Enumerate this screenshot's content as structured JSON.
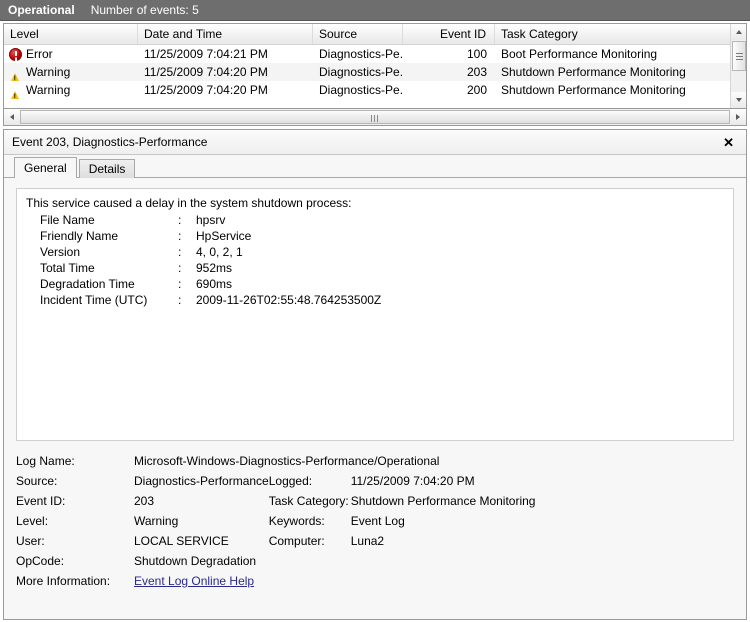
{
  "status_strip": {
    "scope": "Operational",
    "count_text": "Number of events: 5"
  },
  "event_list": {
    "columns": [
      {
        "label": "Level",
        "key": "level"
      },
      {
        "label": "Date and Time",
        "key": "date"
      },
      {
        "label": "Source",
        "key": "source"
      },
      {
        "label": "Event ID",
        "key": "event_id"
      },
      {
        "label": "Task Category",
        "key": "task"
      }
    ],
    "rows": [
      {
        "icon": "error-icon",
        "level": "Error",
        "date": "11/25/2009 7:04:21 PM",
        "source": "Diagnostics-Pe...",
        "event_id": "100",
        "task": "Boot Performance Monitoring"
      },
      {
        "icon": "warning-icon",
        "level": "Warning",
        "date": "11/25/2009 7:04:20 PM",
        "source": "Diagnostics-Pe...",
        "event_id": "203",
        "task": "Shutdown Performance Monitoring"
      },
      {
        "icon": "warning-icon",
        "level": "Warning",
        "date": "11/25/2009 7:04:20 PM",
        "source": "Diagnostics-Pe...",
        "event_id": "200",
        "task": "Shutdown Performance Monitoring"
      }
    ]
  },
  "detail": {
    "title": "Event 203, Diagnostics-Performance",
    "close_label": "✕",
    "tabs": [
      {
        "label": "General",
        "active": true
      },
      {
        "label": "Details",
        "active": false
      }
    ],
    "message": {
      "headline": "This service caused a delay in the system shutdown process:",
      "separator": ":",
      "fields": [
        {
          "key": "File Name",
          "value": "hpsrv"
        },
        {
          "key": "Friendly Name",
          "value": "HpService"
        },
        {
          "key": "Version",
          "value": "4, 0, 2, 1"
        },
        {
          "key": "Total Time",
          "value": "952ms"
        },
        {
          "key": "Degradation Time",
          "value": "690ms"
        },
        {
          "key": "Incident Time (UTC)",
          "value": "2009-11-26T02:55:48.764253500Z"
        }
      ]
    },
    "meta": {
      "log_name_label": "Log Name:",
      "log_name_value": "Microsoft-Windows-Diagnostics-Performance/Operational",
      "source_label": "Source:",
      "source_value": "Diagnostics-Performance",
      "logged_label": "Logged:",
      "logged_value": "11/25/2009 7:04:20 PM",
      "event_id_label": "Event ID:",
      "event_id_value": "203",
      "task_category_label": "Task Category:",
      "task_category_value": "Shutdown Performance Monitoring",
      "level_label": "Level:",
      "level_value": "Warning",
      "keywords_label": "Keywords:",
      "keywords_value": "Event Log",
      "user_label": "User:",
      "user_value": "LOCAL SERVICE",
      "computer_label": "Computer:",
      "computer_value": "Luna2",
      "opcode_label": "OpCode:",
      "opcode_value": "Shutdown Degradation",
      "more_info_label": "More Information:",
      "more_info_link": "Event Log Online Help"
    }
  },
  "colors": {
    "status_strip_bg": "#6e6e6e",
    "error": "#c00000",
    "warning": "#f2c317",
    "link": "#2a2a8c"
  }
}
